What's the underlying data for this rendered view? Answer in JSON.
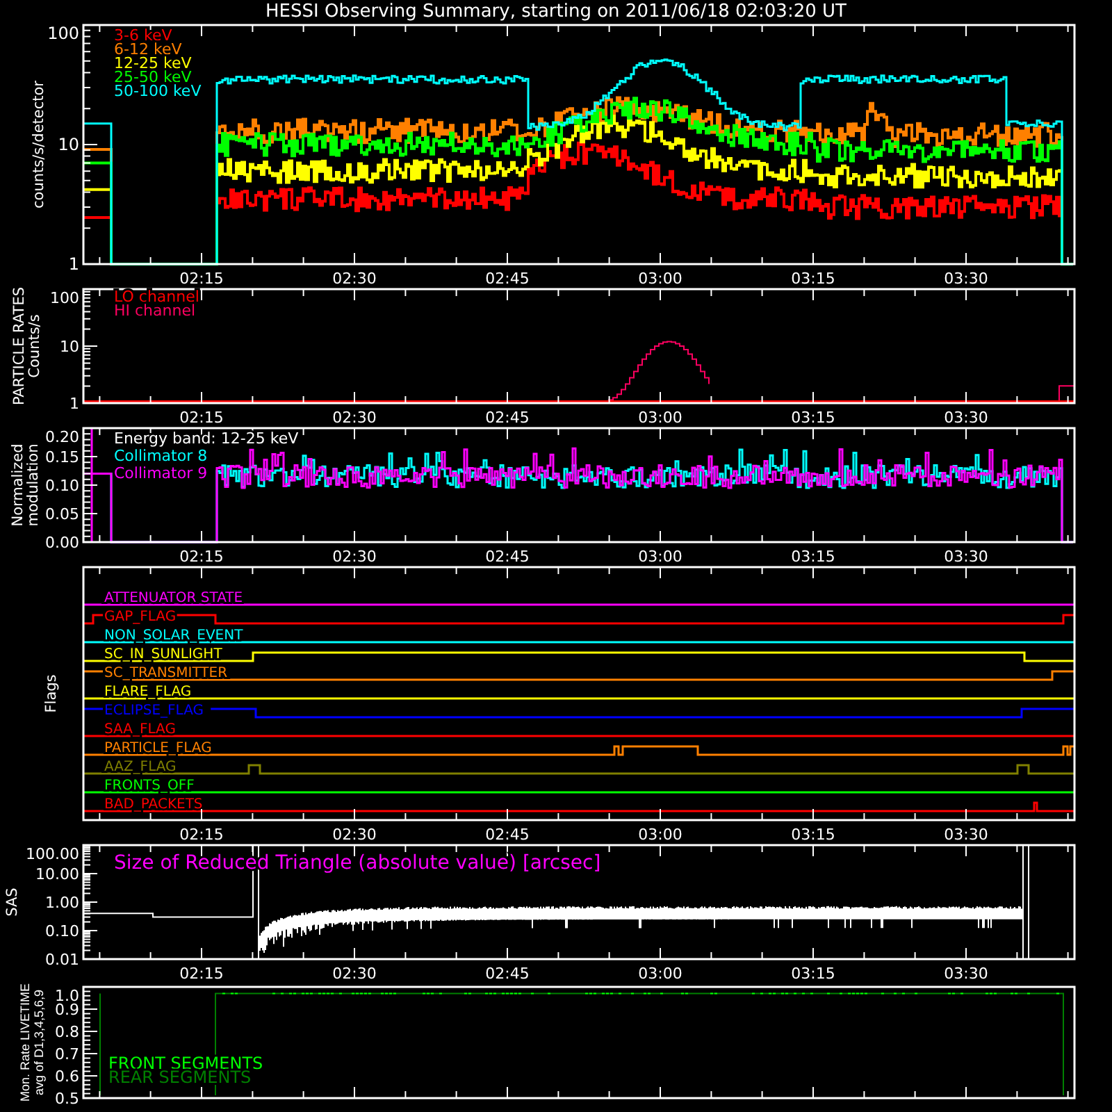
{
  "title": "HESSI Observing Summary, starting on 2011/06/18 02:03:20 UT",
  "panels": [
    {
      "kind": "rates",
      "ylabel": [
        "counts/s/detector"
      ],
      "yticks": [
        "100",
        "10",
        "1"
      ],
      "xticks": [
        "02:15",
        "02:30",
        "02:45",
        "03:00",
        "03:15",
        "03:30"
      ],
      "legend": [
        {
          "label": "3-6 keV",
          "color": "#ff0000"
        },
        {
          "label": "6-12 keV",
          "color": "#ff8000"
        },
        {
          "label": "12-25 keV",
          "color": "#ffff00"
        },
        {
          "label": "25-50 keV",
          "color": "#00ff00"
        },
        {
          "label": "50-100 keV",
          "color": "#00ffff"
        }
      ]
    },
    {
      "kind": "particle",
      "ylabel": [
        "PARTICLE RATES",
        "Counts/s"
      ],
      "yticks": [
        "100",
        "10",
        "1"
      ],
      "xticks": [
        "02:15",
        "02:30",
        "02:45",
        "03:00",
        "03:15",
        "03:30"
      ],
      "legend": [
        {
          "label": "LO channel",
          "color": "#ff0000"
        },
        {
          "label": "HI channel",
          "color": "#ff0060"
        }
      ]
    },
    {
      "kind": "modulation",
      "ylabel": [
        "Normalized",
        "modulation"
      ],
      "yticks": [
        "0.20",
        "0.15",
        "0.10",
        "0.05",
        "0.00"
      ],
      "xticks": [
        "02:15",
        "02:30",
        "02:45",
        "03:00",
        "03:15",
        "03:30"
      ],
      "legend": [
        {
          "label": "Energy band: 12-25 keV",
          "color": "#ffffff"
        },
        {
          "label": "Collimator 8",
          "color": "#00ffff"
        },
        {
          "label": "Collimator 9",
          "color": "#ff00ff"
        }
      ]
    },
    {
      "kind": "flags",
      "ylabel": [
        "Flags"
      ],
      "xticks": [
        "02:15",
        "02:30",
        "02:45",
        "03:00",
        "03:15",
        "03:30"
      ],
      "flags": [
        {
          "label": "ATTENUATOR STATE",
          "color": "#ff00ff"
        },
        {
          "label": "GAP_FLAG",
          "color": "#ff0000"
        },
        {
          "label": "NON_SOLAR_EVENT",
          "color": "#00ffff"
        },
        {
          "label": "SC_IN_SUNLIGHT",
          "color": "#ffff00"
        },
        {
          "label": "SC_TRANSMITTER",
          "color": "#ff8000"
        },
        {
          "label": "FLARE_FLAG",
          "color": "#ffff00"
        },
        {
          "label": "ECLIPSE_FLAG",
          "color": "#0000ff"
        },
        {
          "label": "SAA_FLAG",
          "color": "#ff0000"
        },
        {
          "label": "PARTICLE_FLAG",
          "color": "#ff8000"
        },
        {
          "label": "AAZ_FLAG",
          "color": "#808000"
        },
        {
          "label": "FRONTS_OFF",
          "color": "#00ff00"
        },
        {
          "label": "BAD_PACKETS",
          "color": "#ff0000"
        }
      ]
    },
    {
      "kind": "sas",
      "ylabel": [
        "SAS"
      ],
      "yticks": [
        "100.00",
        "10.00",
        "1.00",
        "0.10",
        "0.01"
      ],
      "xticks": [
        "02:15",
        "02:30",
        "02:45",
        "03:00",
        "03:15",
        "03:30"
      ],
      "legend": [
        {
          "label": "Size of Reduced Triangle (absolute value) [arcsec]",
          "color": "#ff00ff"
        }
      ]
    },
    {
      "kind": "livetime",
      "ylabel": [
        "Mon. Rate LIVETIME",
        "avg of D1,3,4,5,6,9"
      ],
      "yticks": [
        "1.0",
        "0.9",
        "0.8",
        "0.7",
        "0.6",
        "0.5"
      ],
      "legend": [
        {
          "label": "FRONT SEGMENTS",
          "color": "#00ff00"
        },
        {
          "label": "REAR SEGMENTS",
          "color": "#008000"
        }
      ]
    }
  ]
}
